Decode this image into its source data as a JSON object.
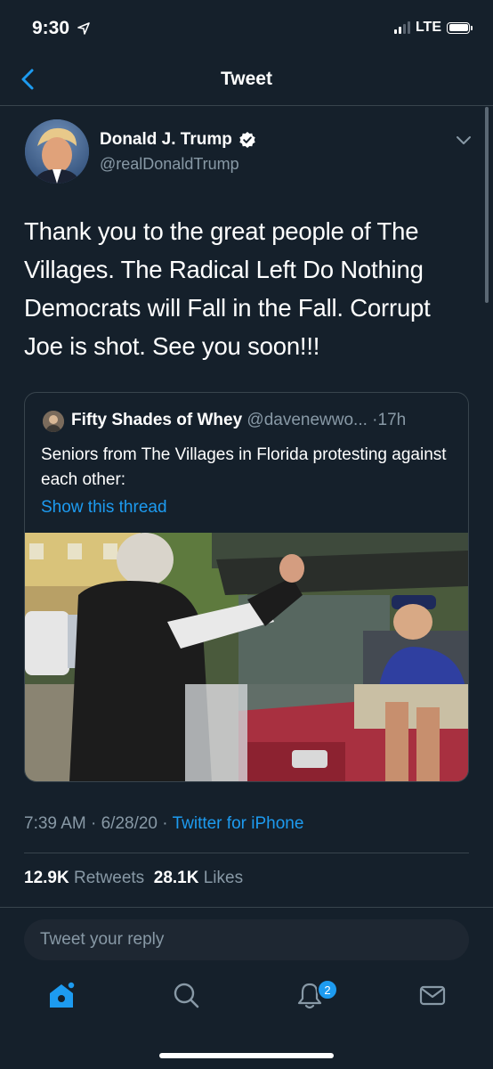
{
  "status_bar": {
    "time": "9:30",
    "network": "LTE"
  },
  "header": {
    "title": "Tweet"
  },
  "tweet": {
    "author_name": "Donald J. Trump",
    "author_handle": "@realDonaldTrump",
    "text": "Thank you to the great people of The Villages. The Radical Left Do Nothing Democrats will Fall in the Fall. Corrupt Joe is shot. See you soon!!!",
    "time": "7:39 AM",
    "date": "6/28/20",
    "source": "Twitter for iPhone",
    "retweets_count": "12.9K",
    "retweets_label": "Retweets",
    "likes_count": "28.1K",
    "likes_label": "Likes"
  },
  "quoted_tweet": {
    "author_name": "Fifty Shades of Whey",
    "author_handle": "@davenewwo...",
    "time": "17h",
    "text": "Seniors from The Villages in Florida protesting against each other:",
    "thread_link": "Show this thread"
  },
  "reply": {
    "placeholder": "Tweet your reply"
  },
  "tab_bar": {
    "items": [
      "home",
      "search",
      "notifications",
      "messages"
    ],
    "notification_badge": "2"
  },
  "colors": {
    "background": "#15202b",
    "accent": "#1d9bf0",
    "secondary_text": "#8899a6",
    "border": "#38444d"
  }
}
